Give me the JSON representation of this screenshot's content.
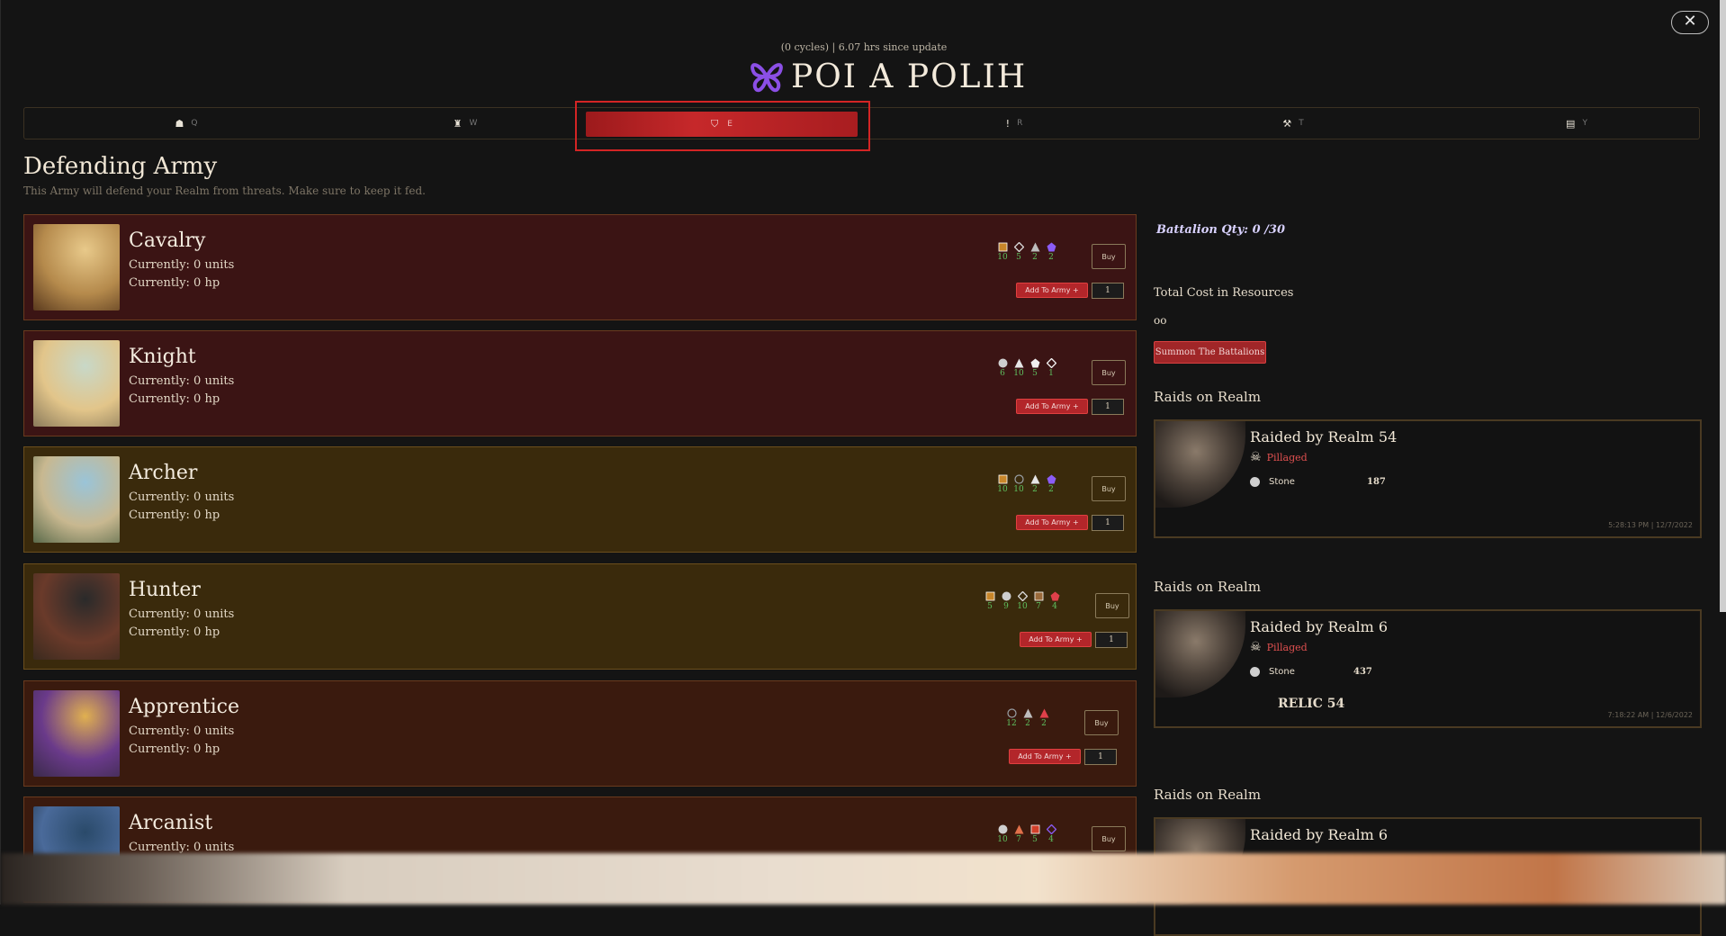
{
  "header": {
    "subtitle": "(0 cycles) | 6.07 hrs since update",
    "logo_text": "POI A POLIH",
    "close_label": "✕"
  },
  "tabs": [
    {
      "icon": "home-icon",
      "glyph": "☗",
      "key": "Q"
    },
    {
      "icon": "tower-icon",
      "glyph": "♜",
      "key": "W"
    },
    {
      "icon": "shield-icon",
      "glyph": "⛉",
      "key": "E"
    },
    {
      "icon": "alert-icon",
      "glyph": "!",
      "key": "R"
    },
    {
      "icon": "hammer-icon",
      "glyph": "⚒",
      "key": "T"
    },
    {
      "icon": "book-icon",
      "glyph": "▤",
      "key": "Y"
    }
  ],
  "page": {
    "title": "Defending Army",
    "description": "This Army will defend your Realm from threats. Make sure to keep it fed."
  },
  "units": [
    {
      "name": "Cavalry",
      "units": "Currently: 0 units",
      "hp": "Currently: 0 hp",
      "theme": "red",
      "costs": [
        {
          "shape": "square",
          "color": "#c8862a",
          "value": "10"
        },
        {
          "shape": "diamond",
          "color": "#dcdcdc",
          "value": "5"
        },
        {
          "shape": "triangle",
          "color": "#bdbdbd",
          "value": "2"
        },
        {
          "shape": "pentagon",
          "color": "#8b5cf6",
          "value": "2"
        }
      ],
      "buy_label": "Buy",
      "add_label": "Add To Army +",
      "qty": "1"
    },
    {
      "name": "Knight",
      "units": "Currently: 0 units",
      "hp": "Currently: 0 hp",
      "theme": "red",
      "costs": [
        {
          "shape": "circle",
          "color": "#cfcfcf",
          "value": "6"
        },
        {
          "shape": "triangle",
          "color": "#e6e6e6",
          "value": "10"
        },
        {
          "shape": "pentagon",
          "color": "#f0f0f0",
          "value": "5"
        },
        {
          "shape": "diamond",
          "color": "#f5f5f5",
          "value": "1"
        }
      ],
      "buy_label": "Buy",
      "add_label": "Add To Army +",
      "qty": "1"
    },
    {
      "name": "Archer",
      "units": "Currently: 0 units",
      "hp": "Currently: 0 hp",
      "theme": "gold",
      "costs": [
        {
          "shape": "square",
          "color": "#c8862a",
          "value": "10"
        },
        {
          "shape": "circle-outline",
          "color": "#9aa0a6",
          "value": "10"
        },
        {
          "shape": "triangle",
          "color": "#e6e6e6",
          "value": "2"
        },
        {
          "shape": "pentagon",
          "color": "#8b5cf6",
          "value": "2"
        }
      ],
      "buy_label": "Buy",
      "add_label": "Add To Army +",
      "qty": "1"
    },
    {
      "name": "Hunter",
      "units": "Currently: 0 units",
      "hp": "Currently: 0 hp",
      "theme": "gold",
      "costs": [
        {
          "shape": "square",
          "color": "#c8862a",
          "value": "5"
        },
        {
          "shape": "circle",
          "color": "#cfcfcf",
          "value": "9"
        },
        {
          "shape": "diamond",
          "color": "#dcdcdc",
          "value": "10"
        },
        {
          "shape": "square",
          "color": "#9a6a3a",
          "value": "7"
        },
        {
          "shape": "pentagon",
          "color": "#e0404a",
          "value": "4"
        }
      ],
      "buy_label": "Buy",
      "add_label": "Add To Army +",
      "qty": "1"
    },
    {
      "name": "Apprentice",
      "units": "Currently: 0 units",
      "hp": "Currently: 0 hp",
      "theme": "brown",
      "costs": [
        {
          "shape": "circle-outline",
          "color": "#9aa0a6",
          "value": "12"
        },
        {
          "shape": "triangle",
          "color": "#bdbdbd",
          "value": "2"
        },
        {
          "shape": "triangle",
          "color": "#e0404a",
          "value": "2"
        }
      ],
      "buy_label": "Buy",
      "add_label": "Add To Army +",
      "qty": "1"
    },
    {
      "name": "Arcanist",
      "units": "Currently: 0 units",
      "hp": "",
      "theme": "brown",
      "costs": [
        {
          "shape": "circle",
          "color": "#cfcfcf",
          "value": "10"
        },
        {
          "shape": "triangle",
          "color": "#e0704a",
          "value": "7"
        },
        {
          "shape": "square",
          "color": "#d0402a",
          "value": "5"
        },
        {
          "shape": "diamond",
          "color": "#8b5cf6",
          "value": "4"
        }
      ],
      "buy_label": "Buy",
      "add_label": "",
      "qty": ""
    }
  ],
  "sidebar": {
    "battalion": "Battalion Qty: 0 /30",
    "total_cost": "Total Cost in Resources",
    "infinity": "oo",
    "summon_label": "Summon The Battalions"
  },
  "raids": [
    {
      "section_title": "Raids on Realm",
      "title": "Raided by Realm 54",
      "status": "Pillaged",
      "resource": "Stone",
      "amount": "187",
      "relic": "",
      "time": "5:28:13 PM | 12/7/2022"
    },
    {
      "section_title": "Raids on Realm",
      "title": "Raided by Realm 6",
      "status": "Pillaged",
      "resource": "Stone",
      "amount": "437",
      "relic": "RELIC 54",
      "time": "7:18:22 AM | 12/6/2022"
    },
    {
      "section_title": "Raids on Realm",
      "title": "Raided by Realm 6",
      "status": "",
      "resource": "",
      "amount": "",
      "relic": "",
      "time": ""
    }
  ]
}
